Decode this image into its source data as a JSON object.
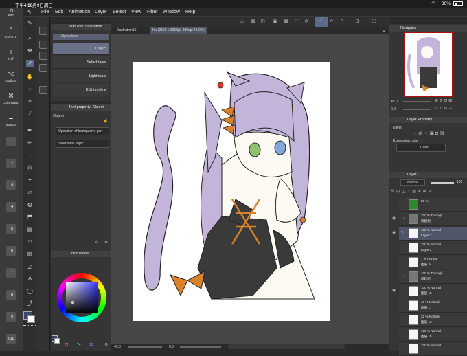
{
  "status": {
    "time": "下午4:56",
    "date": "10月9日周日",
    "battery": "36%"
  },
  "menu": [
    "File",
    "Edit",
    "Animation",
    "Layer",
    "Select",
    "View",
    "Filter",
    "Window",
    "Help"
  ],
  "edge_keys": {
    "esc": "esc",
    "control": "control",
    "shift": "shift",
    "option": "option",
    "command": "command",
    "space": "space",
    "tkeys": [
      "T1",
      "T2",
      "T3",
      "T4",
      "T5",
      "T6",
      "T7",
      "T8",
      "T9",
      "T10"
    ]
  },
  "subtool": {
    "title": "Sub Tool: Operation",
    "tab": "Operation",
    "items": [
      "Object",
      "Select layer",
      "Light table",
      "Edit timeline"
    ]
  },
  "toolprop": {
    "title": "Tool property: Object",
    "label": "Object",
    "dropdown1": "Operation of transparent part",
    "dropdown2": "Selectable object"
  },
  "colorwheel": {
    "title": "Color Wheel",
    "values": [
      "72",
      "74",
      "98"
    ]
  },
  "tabs": [
    "Illustration10",
    "hw (2550 x 3363px 300dpi 45.0%)"
  ],
  "canvas_status": {
    "zoom": "45.0",
    "angle": "0.0"
  },
  "navigator": {
    "title": "Navigator",
    "zoom": "45.0",
    "angle": "0.0"
  },
  "layerprop": {
    "title": "Layer Property",
    "effect": "Effect",
    "expression": "Expression color",
    "color": "Color"
  },
  "layers": {
    "title": "Layer",
    "blend": "Normal",
    "opacity": "100",
    "rows": [
      {
        "a": "50 %",
        "b": ""
      },
      {
        "a": "100 % Through",
        "b": "新建组"
      },
      {
        "a": "100 % Normal",
        "b": "Layer 3"
      },
      {
        "a": "100 % Normal",
        "b": "Layer 2"
      },
      {
        "a": "7 % Normal",
        "b": "图层 24"
      },
      {
        "a": "100 % Through",
        "b": "新建组"
      },
      {
        "a": "100 % Normal",
        "b": "图层 18"
      },
      {
        "a": "13 % Normal",
        "b": "图层 17"
      },
      {
        "a": "22 % Normal",
        "b": "图层 16"
      },
      {
        "a": "100 % Normal",
        "b": "图层 15"
      },
      {
        "a": "100 % Normal",
        "b": ""
      }
    ]
  },
  "colors": {
    "hair": "#c3b4d9",
    "outfit": "#3a3a3a",
    "bow": "#d9822b",
    "skin": "#fdf9f3",
    "eye_green": "#8fc36a",
    "eye_blue": "#7fa7dc",
    "accent": "#6fa0e8"
  }
}
